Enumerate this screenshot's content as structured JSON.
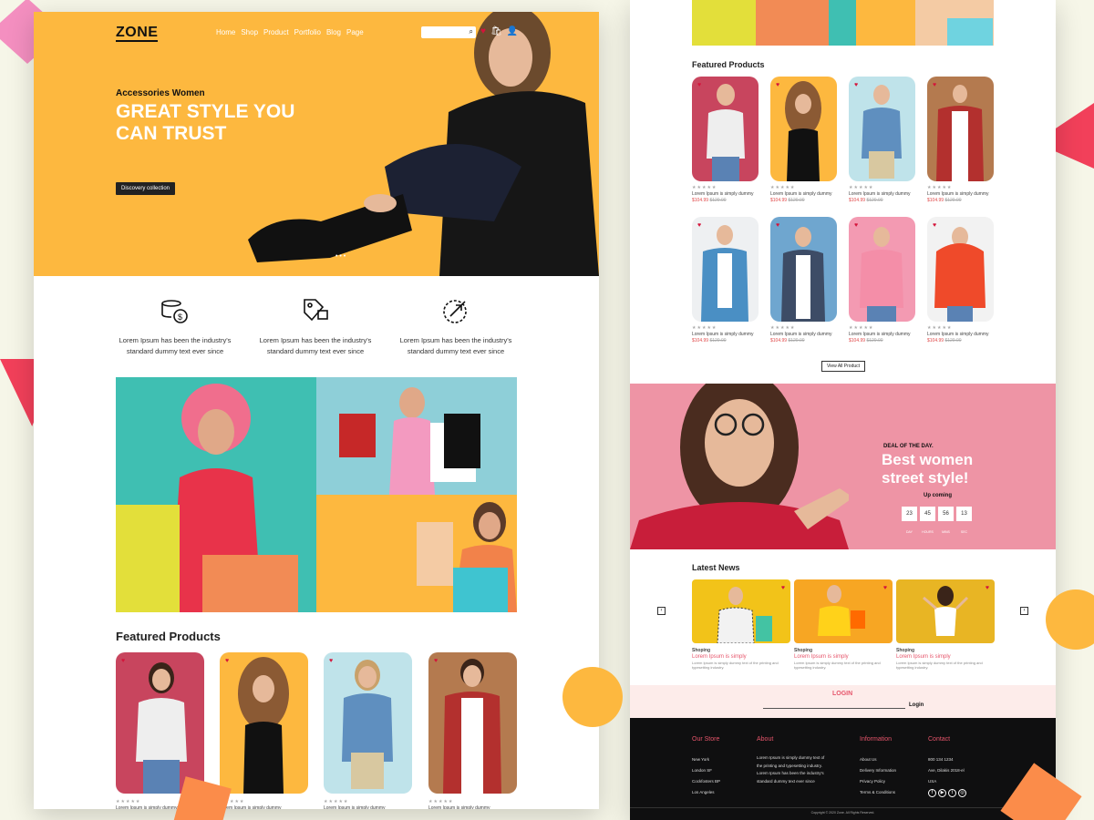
{
  "brand": "ZONE",
  "nav": [
    "Home",
    "Shop",
    "Product",
    "Portfolio",
    "Blog",
    "Page"
  ],
  "hero": {
    "subtitle": "Accessories Women",
    "title": "GREAT STYLE YOU CAN TRUST",
    "button": "Discovery collection",
    "dots": "• • •"
  },
  "features": [
    {
      "icon": "coins-dollar-icon",
      "text": "Lorem Ipsum has been the industry's standard dummy text ever since"
    },
    {
      "icon": "tag-lock-icon",
      "text": "Lorem Ipsum has been the industry's standard dummy text ever since"
    },
    {
      "icon": "rocket-badge-icon",
      "text": "Lorem Ipsum has been the industry's standard dummy text ever since"
    }
  ],
  "featured_title": "Featured Products",
  "product": {
    "name": "Lorem Ipsum is simply dummy",
    "price": "$104.99",
    "old_price": "$120.00",
    "stars": "★★★★★"
  },
  "view_all": "View All Product",
  "deal": {
    "tag": "DEAL OF THE DAY.",
    "title": "Best women street style!",
    "upcoming": "Up coming",
    "countdown": [
      {
        "value": "23",
        "label": "DAY"
      },
      {
        "value": "45",
        "label": "HOURS"
      },
      {
        "value": "56",
        "label": "MINS"
      },
      {
        "value": "13",
        "label": "SEC"
      }
    ]
  },
  "news": {
    "title": "Latest News",
    "category": "Shoping",
    "headline": "Lorem Ipsum is simply",
    "body": "Lorem Ipsum is simply dummy text of the printing and typesetting industry."
  },
  "login": {
    "title": "LOGIN",
    "button": "Login"
  },
  "footer": {
    "cols": [
      {
        "title": "Our Store",
        "items": [
          "New York",
          "London SF",
          "Cockfosters BP",
          "Los Angeles"
        ]
      },
      {
        "title": "About",
        "items": [
          "Lorem Ipsum is simply dummy text of",
          "the printing and typesetting industry.",
          "Lorem Ipsum has been the industry's",
          "standard dummy text ever since"
        ]
      },
      {
        "title": "Information",
        "items": [
          "About Us",
          "Delivery Information",
          "Privacy Policy",
          "Terms & Conditions"
        ]
      },
      {
        "title": "Contact",
        "items": [
          "800 134 1234",
          "Ave, Dilakis 2018-el",
          "USA"
        ]
      }
    ],
    "copyright": "Copyright © 2020 Zone. All Rights Reserved."
  }
}
